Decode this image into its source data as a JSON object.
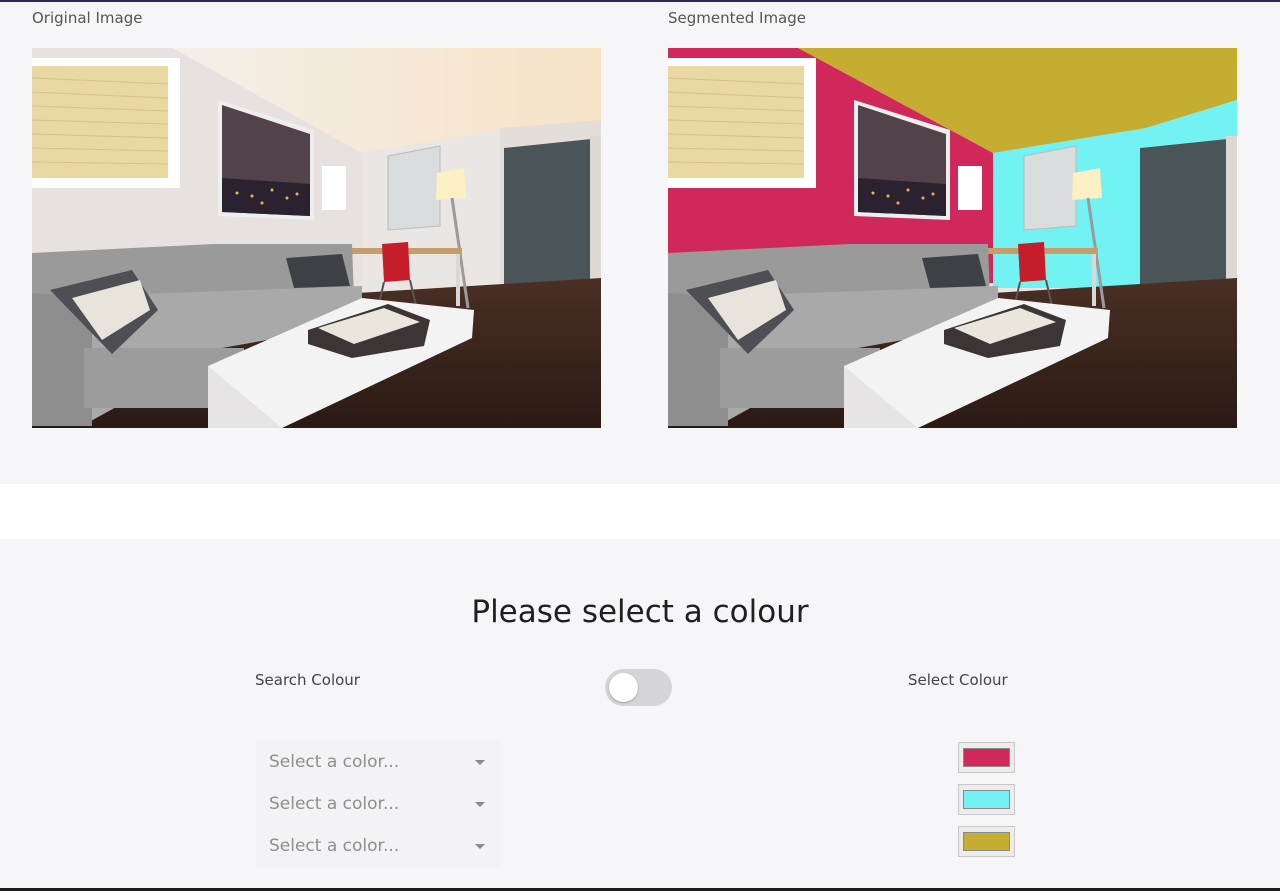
{
  "images": {
    "original_caption": "Original Image",
    "segmented_caption": "Segmented Image"
  },
  "colour_panel": {
    "title": "Please select a colour",
    "search_label": "Search Colour",
    "select_label": "Select Colour",
    "toggle_state": "off",
    "selects": [
      {
        "placeholder": "Select a color..."
      },
      {
        "placeholder": "Select a color..."
      },
      {
        "placeholder": "Select a color..."
      }
    ],
    "swatches": [
      "#d0285a",
      "#72f2f2",
      "#c4ad30"
    ]
  }
}
